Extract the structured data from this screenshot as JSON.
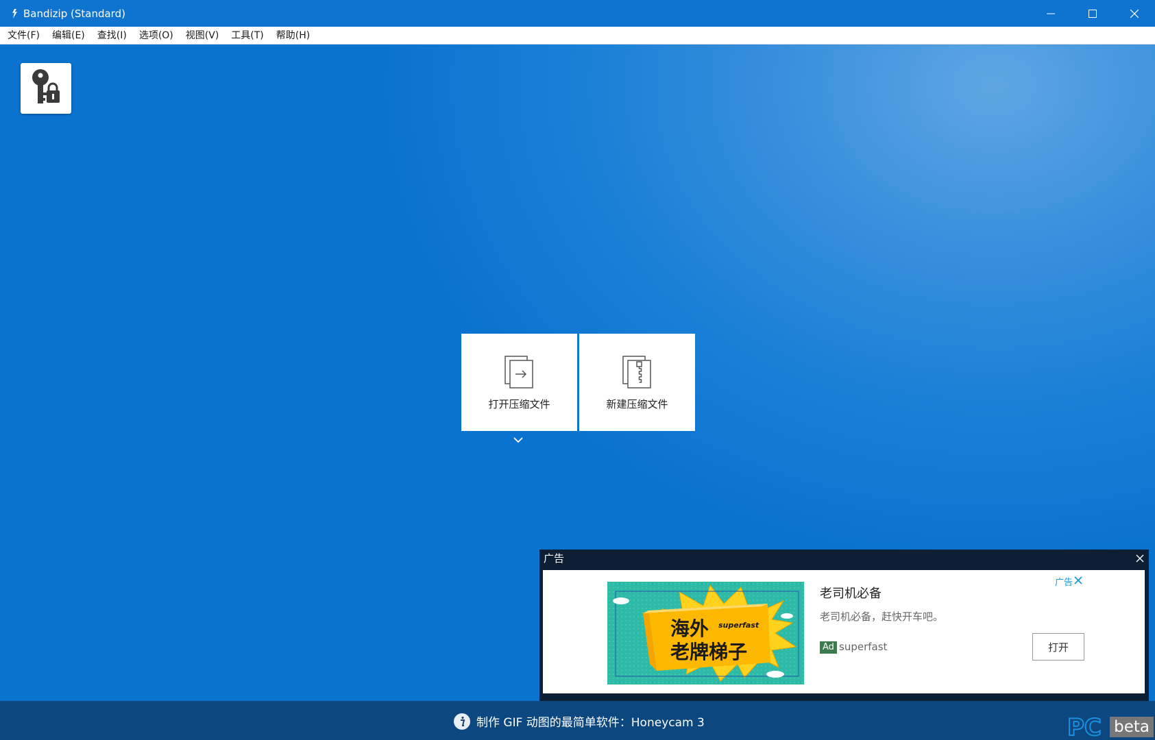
{
  "window": {
    "title": "Bandizip (Standard)"
  },
  "menu": {
    "items": [
      "文件(F)",
      "编辑(E)",
      "查找(I)",
      "选项(O)",
      "视图(V)",
      "工具(T)",
      "帮助(H)"
    ]
  },
  "toolbar": {
    "password_tool_icon": "key-lock-icon"
  },
  "actions": {
    "open_label": "打开压缩文件",
    "new_label": "新建压缩文件"
  },
  "ad": {
    "header": "广告",
    "headline": "老司机必备",
    "description": "老司机必备，赶快开车吧。",
    "badge": "Ad",
    "brand": "superfast",
    "open_button": "打开",
    "choice_label": "广告",
    "image_text_line1": "海外",
    "image_text_line2": "老牌梯子",
    "image_brand": "superfast"
  },
  "status": {
    "message": "制作 GIF 动图的最简单软件：Honeycam 3"
  },
  "watermark": {
    "logo": "PC",
    "label": "beta"
  },
  "colors": {
    "title_bar": "#0f73d0",
    "background": "#0a72cf",
    "status_bar": "#0c477f",
    "ad_badge": "#3d7a4c",
    "ad_choice": "#1d9ad6"
  }
}
